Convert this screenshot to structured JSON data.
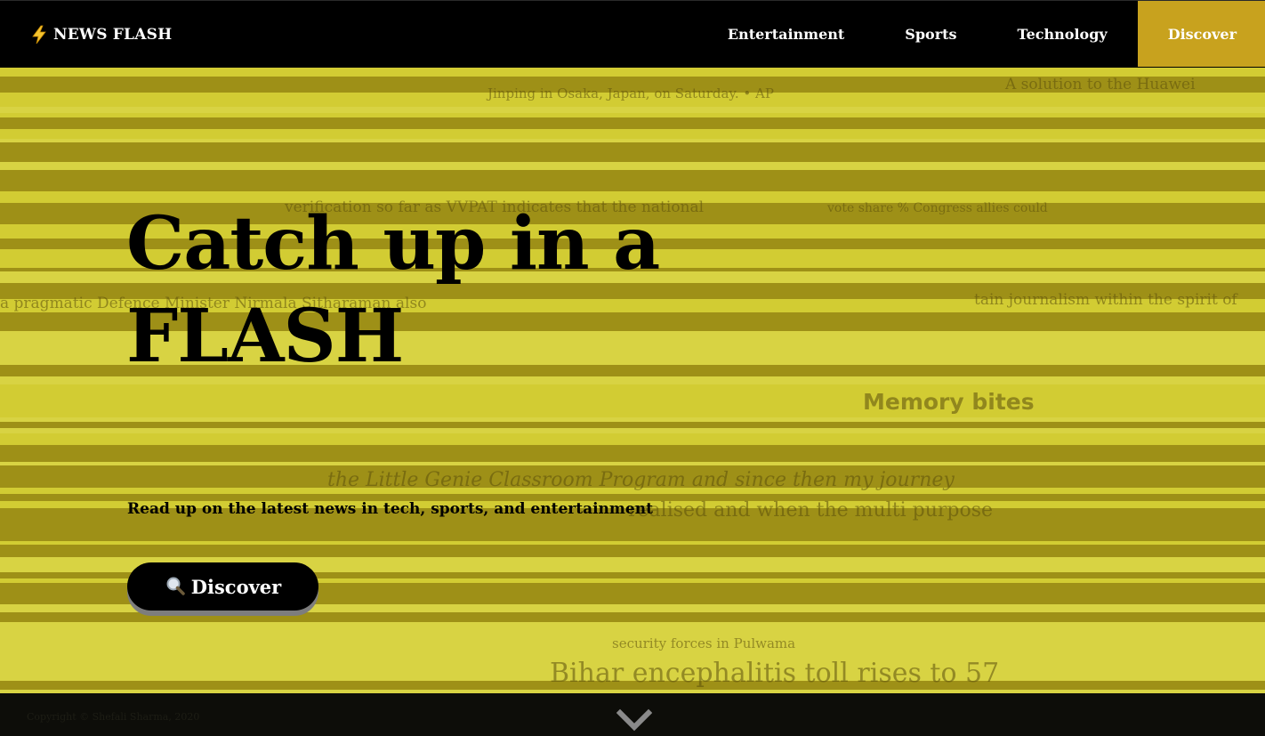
{
  "brand": {
    "name": "NEWS FLASH",
    "icon": "lightning-bolt-icon"
  },
  "nav": {
    "items": [
      {
        "label": "Entertainment",
        "active": false
      },
      {
        "label": "Sports",
        "active": false
      },
      {
        "label": "Technology",
        "active": false
      },
      {
        "label": "Discover",
        "active": true
      }
    ]
  },
  "hero": {
    "title_line1": "Catch up in a",
    "title_line2": "FLASH",
    "subtitle": "Read up on the latest news in tech, sports, and entertainment",
    "cta_label": "Discover",
    "cta_icon": "magnifying-glass-icon",
    "background_words": [
      "Jinping in Osaka, Japan, on Saturday. • AP",
      "A solution to the Huawei",
      "verification so far as VVPAT  indicates that the national",
      "vote share %   Congress   allies could",
      "a pragmatic    Defence Minister Nirmala Sitharaman also",
      "tain journalism within the spirit of",
      "Memory bites",
      "the Little Genie Classroom Program and since then my journey",
      "realised and when the multi purpose",
      "security forces in Pulwama",
      "Bihar encephalitis toll rises to 57"
    ]
  },
  "footer": {
    "copyright": "Copyright © Shefali Sharma, 2020",
    "scroll_icon": "chevron-down-icon"
  },
  "colors": {
    "navbar_bg": "#000000",
    "accent": "#c8a21e",
    "hero_tint": "#c9c22a",
    "button_bg": "#000000",
    "footer_bg": "#0d0d09"
  }
}
